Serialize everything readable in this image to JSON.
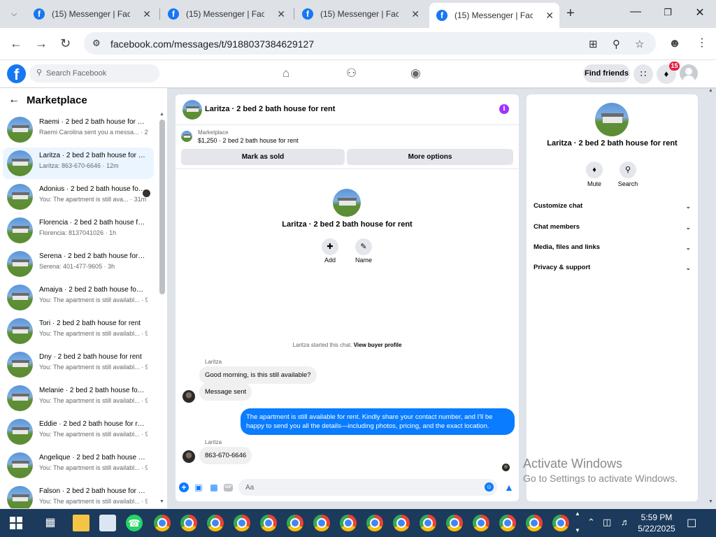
{
  "browser": {
    "tabs": [
      {
        "title": "(15) Messenger | Facebook",
        "active": false
      },
      {
        "title": "(15) Messenger | Facebook",
        "active": false
      },
      {
        "title": "(15) Messenger | Facebook",
        "active": false
      },
      {
        "title": "(15) Messenger | Facebook",
        "active": true
      }
    ],
    "url": "facebook.com/messages/t/9188037384629127"
  },
  "fb": {
    "logo": "f",
    "search_placeholder": "Search Facebook",
    "find_friends": "Find friends",
    "notification_count": "15"
  },
  "sidebar": {
    "title": "Marketplace",
    "conversations": [
      {
        "name": "Raemi · 2 bed 2 bath house for rent",
        "preview": "Raemi Carolina sent you a messa...",
        "time": "· 2m"
      },
      {
        "name": "Laritza · 2 bed 2 bath house for rent",
        "preview": "Laritza: 863-670-6646",
        "time": "· 12m"
      },
      {
        "name": "Adonius · 2 bed 2 bath house for rent",
        "preview": "You: The apartment is still ava...",
        "time": "· 31m"
      },
      {
        "name": "Florencia · 2 bed 2 bath house for rent",
        "preview": "Florencia: 8137041026",
        "time": "· 1h"
      },
      {
        "name": "Serena · 2 bed 2 bath house for rent",
        "preview": "Serena: 401-477-9605",
        "time": "· 3h"
      },
      {
        "name": "Amaiya · 2 bed 2 bath house for rent",
        "preview": "You: The apartment is still availabl...",
        "time": "· 9h"
      },
      {
        "name": "Tori · 2 bed 2 bath house for rent",
        "preview": "You: The apartment is still availabl...",
        "time": "· 9h"
      },
      {
        "name": "Dny · 2 bed 2 bath house for rent",
        "preview": "You: The apartment is still availabl...",
        "time": "· 9h"
      },
      {
        "name": "Melanie · 2 bed 2 bath house for rent",
        "preview": "You: The apartment is still availabl...",
        "time": "· 9h"
      },
      {
        "name": "Eddie · 2 bed 2 bath house for rent",
        "preview": "You: The apartment is still availabl...",
        "time": "· 9h"
      },
      {
        "name": "Angelique · 2 bed 2 bath house for rent",
        "preview": "You: The apartment is still availabl...",
        "time": "· 9h"
      },
      {
        "name": "Falson · 2 bed 2 bath house for rent",
        "preview": "You: The apartment is still availabl...",
        "time": "· 9h"
      }
    ]
  },
  "chat": {
    "title": "Laritza · 2 bed 2 bath house for rent",
    "marketplace_label": "Marketplace",
    "listing": "$1,250 · 2 bed 2 bath house for rent",
    "mark_sold": "Mark as sold",
    "more_options": "More options",
    "add_label": "Add",
    "name_label": "Name",
    "started_text": "Laritza started this chat.",
    "view_profile": "View buyer profile",
    "messages": [
      {
        "sender": "Laritza",
        "text": "Good morning, is this still available?"
      },
      {
        "text": "Message sent"
      },
      {
        "text": "The apartment is still available for rent. Kindly share your contact number, and I'll be happy to send you all the details—including photos, pricing, and the exact location."
      },
      {
        "sender": "Laritza",
        "text": "863-670-6646"
      }
    ],
    "composer_placeholder": "Aa",
    "gif_label": "GIF"
  },
  "right_panel": {
    "title": "Laritza · 2 bed 2 bath house for rent",
    "mute": "Mute",
    "search": "Search",
    "rows": [
      "Customize chat",
      "Chat members",
      "Media, files and links",
      "Privacy & support"
    ]
  },
  "watermark": {
    "line1": "Activate Windows",
    "line2": "Go to Settings to activate Windows."
  },
  "taskbar": {
    "time": "5:59 PM",
    "date": "5/22/2025"
  },
  "colors": {
    "fb_blue": "#1877f2",
    "message_blue": "#0a7cff",
    "taskbar": "#1b3a5c"
  }
}
